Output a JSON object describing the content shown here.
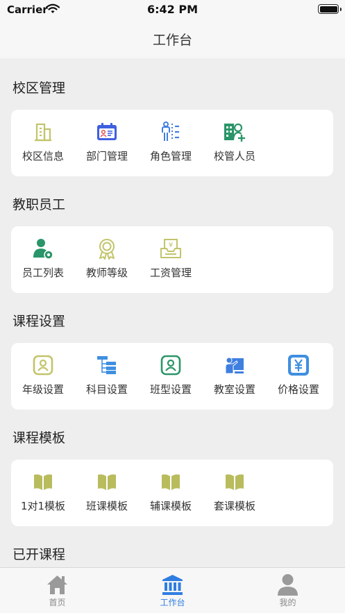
{
  "status_bar": {
    "carrier": "Carrier",
    "time": "6:42 PM"
  },
  "nav": {
    "title": "工作台"
  },
  "sections": [
    {
      "title": "校区管理",
      "items": [
        {
          "label": "校区信息",
          "icon": "building-icon"
        },
        {
          "label": "部门管理",
          "icon": "id-card-icon"
        },
        {
          "label": "角色管理",
          "icon": "role-icon"
        },
        {
          "label": "校管人员",
          "icon": "staff-add-icon"
        }
      ]
    },
    {
      "title": "教职员工",
      "items": [
        {
          "label": "员工列表",
          "icon": "user-gear-icon"
        },
        {
          "label": "教师等级",
          "icon": "medal-icon"
        },
        {
          "label": "工资管理",
          "icon": "salary-icon"
        }
      ]
    },
    {
      "title": "课程设置",
      "items": [
        {
          "label": "年级设置",
          "icon": "portrait-frame-icon"
        },
        {
          "label": "科目设置",
          "icon": "tree-icon"
        },
        {
          "label": "班型设置",
          "icon": "portrait-frame-icon"
        },
        {
          "label": "教室设置",
          "icon": "classroom-icon"
        },
        {
          "label": "价格设置",
          "icon": "yen-icon"
        }
      ]
    },
    {
      "title": "课程模板",
      "items": [
        {
          "label": "1对1模板",
          "icon": "book-icon"
        },
        {
          "label": "班课模板",
          "icon": "book-icon"
        },
        {
          "label": "辅课模板",
          "icon": "book-icon"
        },
        {
          "label": "套课模板",
          "icon": "book-icon"
        }
      ]
    },
    {
      "title": "已开课程",
      "items": []
    }
  ],
  "tabs": [
    {
      "label": "首页",
      "icon": "home-icon",
      "active": false
    },
    {
      "label": "工作台",
      "icon": "bank-icon",
      "active": true
    },
    {
      "label": "我的",
      "icon": "person-icon",
      "active": false
    }
  ],
  "colors": {
    "olive": "#c2c46a",
    "green": "#2a9568",
    "blue": "#3f7fe0",
    "active_tab": "#2f7de1",
    "inactive_tab": "#9a9a9a"
  }
}
